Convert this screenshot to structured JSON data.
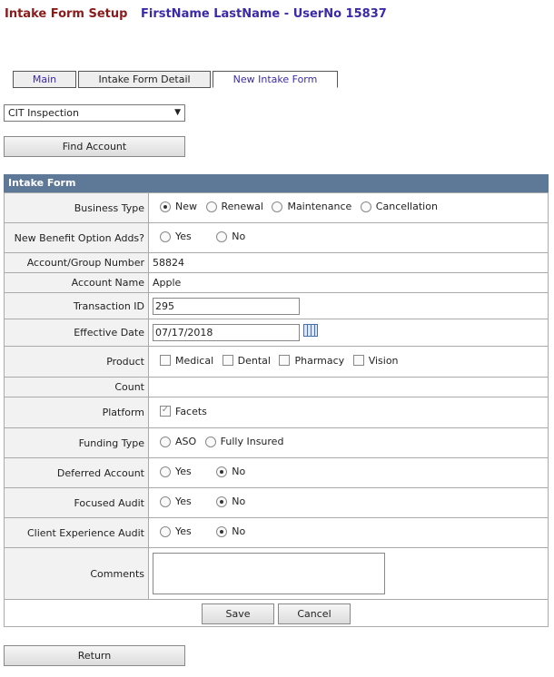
{
  "header": {
    "title": "Intake Form Setup",
    "user": "FirstName LastName - UserNo 15837"
  },
  "tabs": [
    {
      "label": "Main"
    },
    {
      "label": "Intake Form Detail"
    },
    {
      "label": "New Intake Form"
    }
  ],
  "inspection_select": {
    "value": "CIT Inspection"
  },
  "find_account_label": "Find Account",
  "form": {
    "title": "Intake Form",
    "business_type": {
      "label": "Business Type",
      "options": [
        "New",
        "Renewal",
        "Maintenance",
        "Cancellation"
      ],
      "selected": "New"
    },
    "new_benefit": {
      "label": "New Benefit Option Adds?",
      "options": [
        "Yes",
        "No"
      ],
      "selected": ""
    },
    "account_group_number": {
      "label": "Account/Group Number",
      "value": "58824"
    },
    "account_name": {
      "label": "Account Name",
      "value": "Apple"
    },
    "transaction_id": {
      "label": "Transaction ID",
      "value": "295"
    },
    "effective_date": {
      "label": "Effective Date",
      "value": "07/17/2018"
    },
    "product": {
      "label": "Product",
      "options": [
        "Medical",
        "Dental",
        "Pharmacy",
        "Vision"
      ]
    },
    "count": {
      "label": "Count"
    },
    "platform": {
      "label": "Platform",
      "option": "Facets"
    },
    "funding_type": {
      "label": "Funding Type",
      "options": [
        "ASO",
        "Fully Insured"
      ],
      "selected": ""
    },
    "deferred_account": {
      "label": "Deferred Account",
      "options": [
        "Yes",
        "No"
      ],
      "selected": "No"
    },
    "focused_audit": {
      "label": "Focused Audit",
      "options": [
        "Yes",
        "No"
      ],
      "selected": "No"
    },
    "client_experience_audit": {
      "label": "Client Experience Audit",
      "options": [
        "Yes",
        "No"
      ],
      "selected": "No"
    },
    "comments": {
      "label": "Comments",
      "value": ""
    }
  },
  "buttons": {
    "save": "Save",
    "cancel": "Cancel",
    "return": "Return"
  }
}
